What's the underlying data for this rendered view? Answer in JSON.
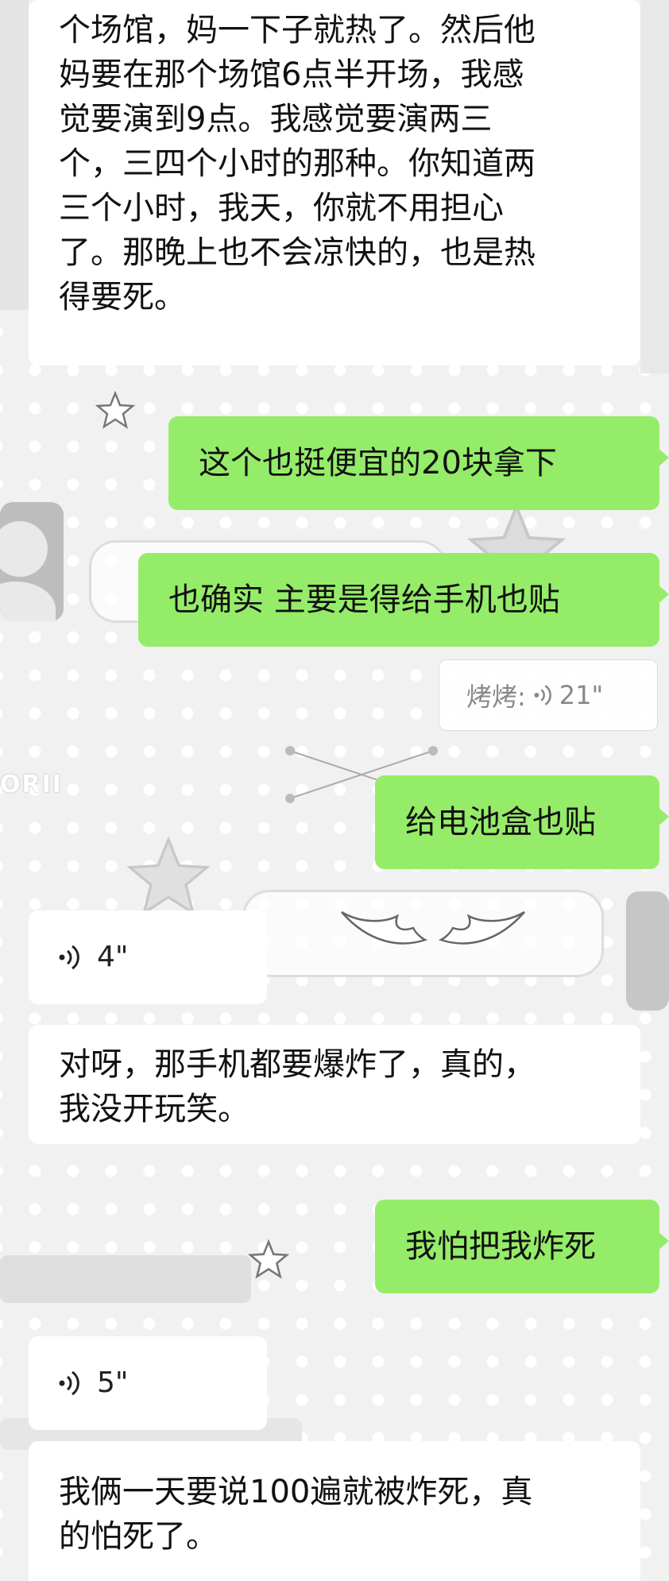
{
  "messages": [
    {
      "side": "incoming",
      "type": "text",
      "text": "个场馆，妈一下子就热了。然后他\n妈要在那个场馆6点半开场，我感\n觉要演到9点。我感觉要演两三\n个，三四个小时的那种。你知道两\n三个小时，我天，你就不用担心\n了。那晚上也不会凉快的，也是热\n得要死。"
    },
    {
      "side": "outgoing",
      "type": "text",
      "text": "这个也挺便宜的20块拿下"
    },
    {
      "side": "outgoing",
      "type": "text",
      "text": "也确实 主要是得给手机也贴"
    },
    {
      "side": "outgoing",
      "type": "text",
      "text": "给电池盒也贴"
    },
    {
      "side": "incoming",
      "type": "voice",
      "duration": "4\""
    },
    {
      "side": "incoming",
      "type": "text",
      "text": "对呀，那手机都要爆炸了，真的，\n我没开玩笑。"
    },
    {
      "side": "outgoing",
      "type": "text",
      "text": "我怕把我炸死"
    },
    {
      "side": "incoming",
      "type": "voice",
      "duration": "5\""
    },
    {
      "side": "incoming",
      "type": "text",
      "text": "我俩一天要说100遍就被炸死，真\n的怕死了。"
    }
  ],
  "quoted_voice": {
    "sender": "烤烤:",
    "duration": "21\""
  },
  "background": {
    "watermark": "ORII"
  },
  "colors": {
    "outgoing_bubble": "#95ec69",
    "incoming_bubble": "#ffffff",
    "chat_background": "#f1f1f1"
  }
}
